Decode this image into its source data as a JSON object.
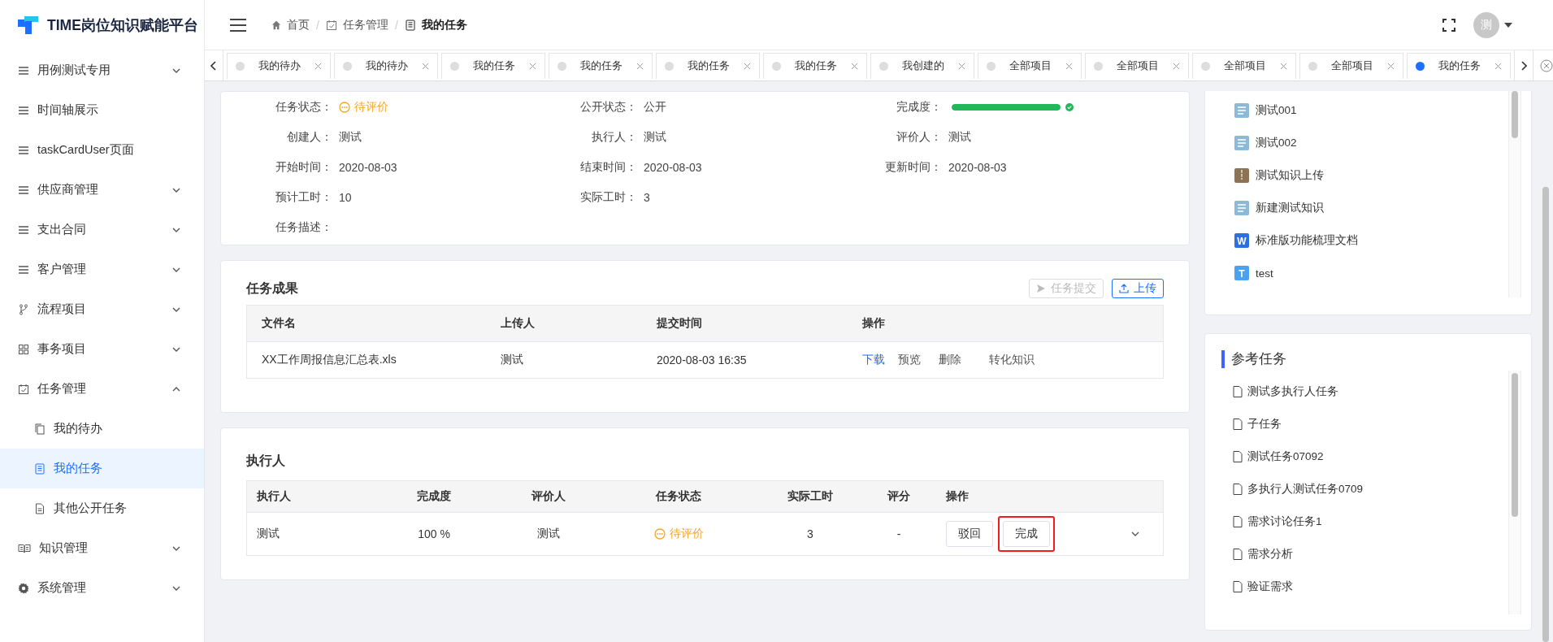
{
  "app": {
    "title": "TIME岗位知识赋能平台"
  },
  "sidebar": {
    "items": [
      {
        "label": "用例测试专用",
        "expanded": false,
        "selected": false
      },
      {
        "label": "时间轴展示",
        "selected": false
      },
      {
        "label": "taskCardUser页面",
        "selected": false
      },
      {
        "label": "供应商管理",
        "expanded": false,
        "selected": false
      },
      {
        "label": "支出合同",
        "expanded": false,
        "selected": false
      },
      {
        "label": "客户管理",
        "expanded": false,
        "selected": false
      },
      {
        "label": "流程项目",
        "expanded": false,
        "selected": false
      },
      {
        "label": "事务项目",
        "expanded": false,
        "selected": false
      },
      {
        "label": "任务管理",
        "expanded": true,
        "selected": false,
        "children": [
          {
            "label": "我的待办",
            "selected": false
          },
          {
            "label": "我的任务",
            "selected": true
          },
          {
            "label": "其他公开任务",
            "selected": false
          }
        ]
      },
      {
        "label": "知识管理",
        "expanded": false,
        "selected": false
      },
      {
        "label": "系统管理",
        "expanded": false,
        "selected": false
      }
    ]
  },
  "header": {
    "breadcrumb": [
      {
        "label": "首页",
        "current": false
      },
      {
        "label": "任务管理",
        "current": false
      },
      {
        "label": "我的任务",
        "current": true
      }
    ],
    "separator": "/",
    "avatar": "测"
  },
  "tabs": [
    {
      "label": "我的待办",
      "selected": false
    },
    {
      "label": "我的待办",
      "selected": false
    },
    {
      "label": "我的任务",
      "selected": false
    },
    {
      "label": "我的任务",
      "selected": false
    },
    {
      "label": "我的任务",
      "selected": false
    },
    {
      "label": "我的任务",
      "selected": false
    },
    {
      "label": "我创建的",
      "selected": false
    },
    {
      "label": "全部项目",
      "selected": false
    },
    {
      "label": "全部项目",
      "selected": false
    },
    {
      "label": "全部项目",
      "selected": false
    },
    {
      "label": "全部项目",
      "selected": false
    },
    {
      "label": "我的任务",
      "selected": true
    }
  ],
  "task_info": {
    "fields": [
      {
        "label": "任务状态：",
        "value": "待评价",
        "kind": "status"
      },
      {
        "label": "公开状态：",
        "value": "公开",
        "kind": "text"
      },
      {
        "label": "完成度：",
        "kind": "progress",
        "level": 1
      },
      {
        "label": "创建人：",
        "value": "测试",
        "kind": "text"
      },
      {
        "label": "执行人：",
        "value": "测试",
        "kind": "text"
      },
      {
        "label": "评价人：",
        "value": "测试",
        "kind": "text"
      },
      {
        "label": "开始时间：",
        "value": "2020-08-03",
        "kind": "text"
      },
      {
        "label": "结束时间：",
        "value": "2020-08-03",
        "kind": "text"
      },
      {
        "label": "更新时间：",
        "value": "2020-08-03",
        "kind": "text"
      },
      {
        "label": "预计工时：",
        "value": "10",
        "kind": "text"
      },
      {
        "label": "实际工时：",
        "value": "3",
        "kind": "text"
      },
      {
        "label": "任务描述：",
        "kind": "description"
      }
    ]
  },
  "results": {
    "title": "任务成果",
    "buttons": [
      {
        "label": "任务提交",
        "disabled": true
      },
      {
        "label": "上传",
        "disabled": false
      }
    ],
    "columns": [
      "文件名",
      "上传人",
      "提交时间",
      "操作"
    ],
    "rows": [
      {
        "cells": [
          "XX工作周报信息汇总表.xls",
          "测试",
          "2020-08-03 16:35"
        ],
        "actions": [
          {
            "label": "下载",
            "kind": "primary"
          },
          {
            "label": "预览",
            "kind": "plain"
          },
          {
            "label": "删除",
            "kind": "plain"
          },
          {
            "label": "转化知识",
            "kind": "plain"
          }
        ]
      }
    ]
  },
  "executors": {
    "title": "执行人",
    "columns": [
      "执行人",
      "完成度",
      "评价人",
      "任务状态",
      "实际工时",
      "评分",
      "操作"
    ],
    "rows": [
      {
        "cells": [
          "测试",
          "100 %",
          "测试"
        ],
        "status": "待评价",
        "hours": "3",
        "score": "-",
        "buttons": [
          {
            "label": "驳回",
            "highlighted": false
          },
          {
            "label": "完成",
            "highlighted": true
          }
        ],
        "expanded": false
      }
    ]
  },
  "knowledge": {
    "items": [
      {
        "label": "测试001",
        "kind": "doc"
      },
      {
        "label": "测试002",
        "kind": "doc"
      },
      {
        "label": "测试知识上传",
        "kind": "zip"
      },
      {
        "label": "新建测试知识",
        "kind": "doc"
      },
      {
        "label": "标准版功能梳理文档",
        "kind": "word",
        "badge": "W"
      },
      {
        "label": "test",
        "kind": "text",
        "badge": "T"
      }
    ]
  },
  "reference_tasks": {
    "title": "参考任务",
    "items": [
      "测试多执行人任务",
      "子任务",
      "测试任务07092",
      "多执行人测试任务0709",
      "需求讨论任务1",
      "需求分析",
      "验证需求"
    ]
  }
}
